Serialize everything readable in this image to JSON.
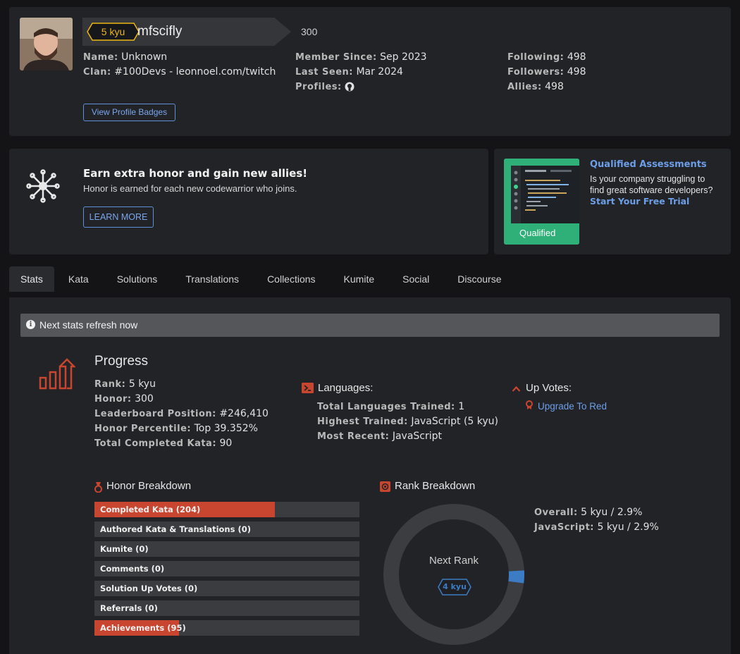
{
  "profile": {
    "rank_badge": "5 kyu",
    "username": "mfscifly",
    "honor_score": "300",
    "col1": [
      {
        "label": "Name:",
        "value": "Unknown"
      },
      {
        "label": "Clan:",
        "value": "#100Devs - leonnoel.com/twitch"
      }
    ],
    "col2": [
      {
        "label": "Member Since:",
        "value": "Sep 2023"
      },
      {
        "label": "Last Seen:",
        "value": "Mar 2024"
      },
      {
        "label": "Profiles:",
        "value": ""
      }
    ],
    "col3": [
      {
        "label": "Following:",
        "value": "498"
      },
      {
        "label": "Followers:",
        "value": "498"
      },
      {
        "label": "Allies:",
        "value": "498"
      }
    ],
    "view_badges_label": "View Profile Badges"
  },
  "earn": {
    "title": "Earn extra honor and gain new allies!",
    "description": "Honor is earned for each new codewarrior who joins.",
    "button": "LEARN MORE"
  },
  "qualified": {
    "image_label": "Qualified",
    "title": "Qualified Assessments",
    "description": "Is your company struggling to find great software developers?",
    "cta": "Start Your Free Trial"
  },
  "tabs": [
    "Stats",
    "Kata",
    "Solutions",
    "Translations",
    "Collections",
    "Kumite",
    "Social",
    "Discourse"
  ],
  "stats": {
    "refresh": "Next stats refresh now",
    "progress_title": "Progress",
    "progress": [
      {
        "label": "Rank:",
        "value": "5 kyu"
      },
      {
        "label": "Honor:",
        "value": "300"
      },
      {
        "label": "Leaderboard Position:",
        "value": "#246,410"
      },
      {
        "label": "Honor Percentile:",
        "value": "Top 39.352%"
      },
      {
        "label": "Total Completed Kata:",
        "value": "90"
      }
    ],
    "languages_title": "Languages:",
    "languages": [
      {
        "label": "Total Languages Trained:",
        "value": "1"
      },
      {
        "label": "Highest Trained:",
        "value": "JavaScript (5 kyu)"
      },
      {
        "label": "Most Recent:",
        "value": "JavaScript"
      }
    ],
    "upvotes_title": "Up Votes:",
    "upvotes_link": "Upgrade To Red",
    "honor_title": "Honor Breakdown",
    "honor_bars": [
      {
        "label": "Completed Kata (204)",
        "fraction": 0.68
      },
      {
        "label": "Authored Kata & Translations (0)",
        "fraction": 0
      },
      {
        "label": "Kumite (0)",
        "fraction": 0
      },
      {
        "label": "Comments (0)",
        "fraction": 0
      },
      {
        "label": "Solution Up Votes (0)",
        "fraction": 0
      },
      {
        "label": "Referrals (0)",
        "fraction": 0
      },
      {
        "label": "Achievements (95)",
        "fraction": 0.32
      }
    ],
    "rank_title": "Rank Breakdown",
    "next_rank_label": "Next Rank",
    "next_rank": "4 kyu",
    "rank_progress": 0.029,
    "rank_rows": [
      {
        "label": "Overall:",
        "value": "5 kyu / 2.9%"
      },
      {
        "label": "JavaScript:",
        "value": "5 kyu / 2.9%"
      }
    ]
  },
  "colors": {
    "accent_red": "#c8462f",
    "accent_blue": "#3c7cc4",
    "badge_yellow": "#ecb613",
    "link_blue": "#6d9ee8"
  }
}
